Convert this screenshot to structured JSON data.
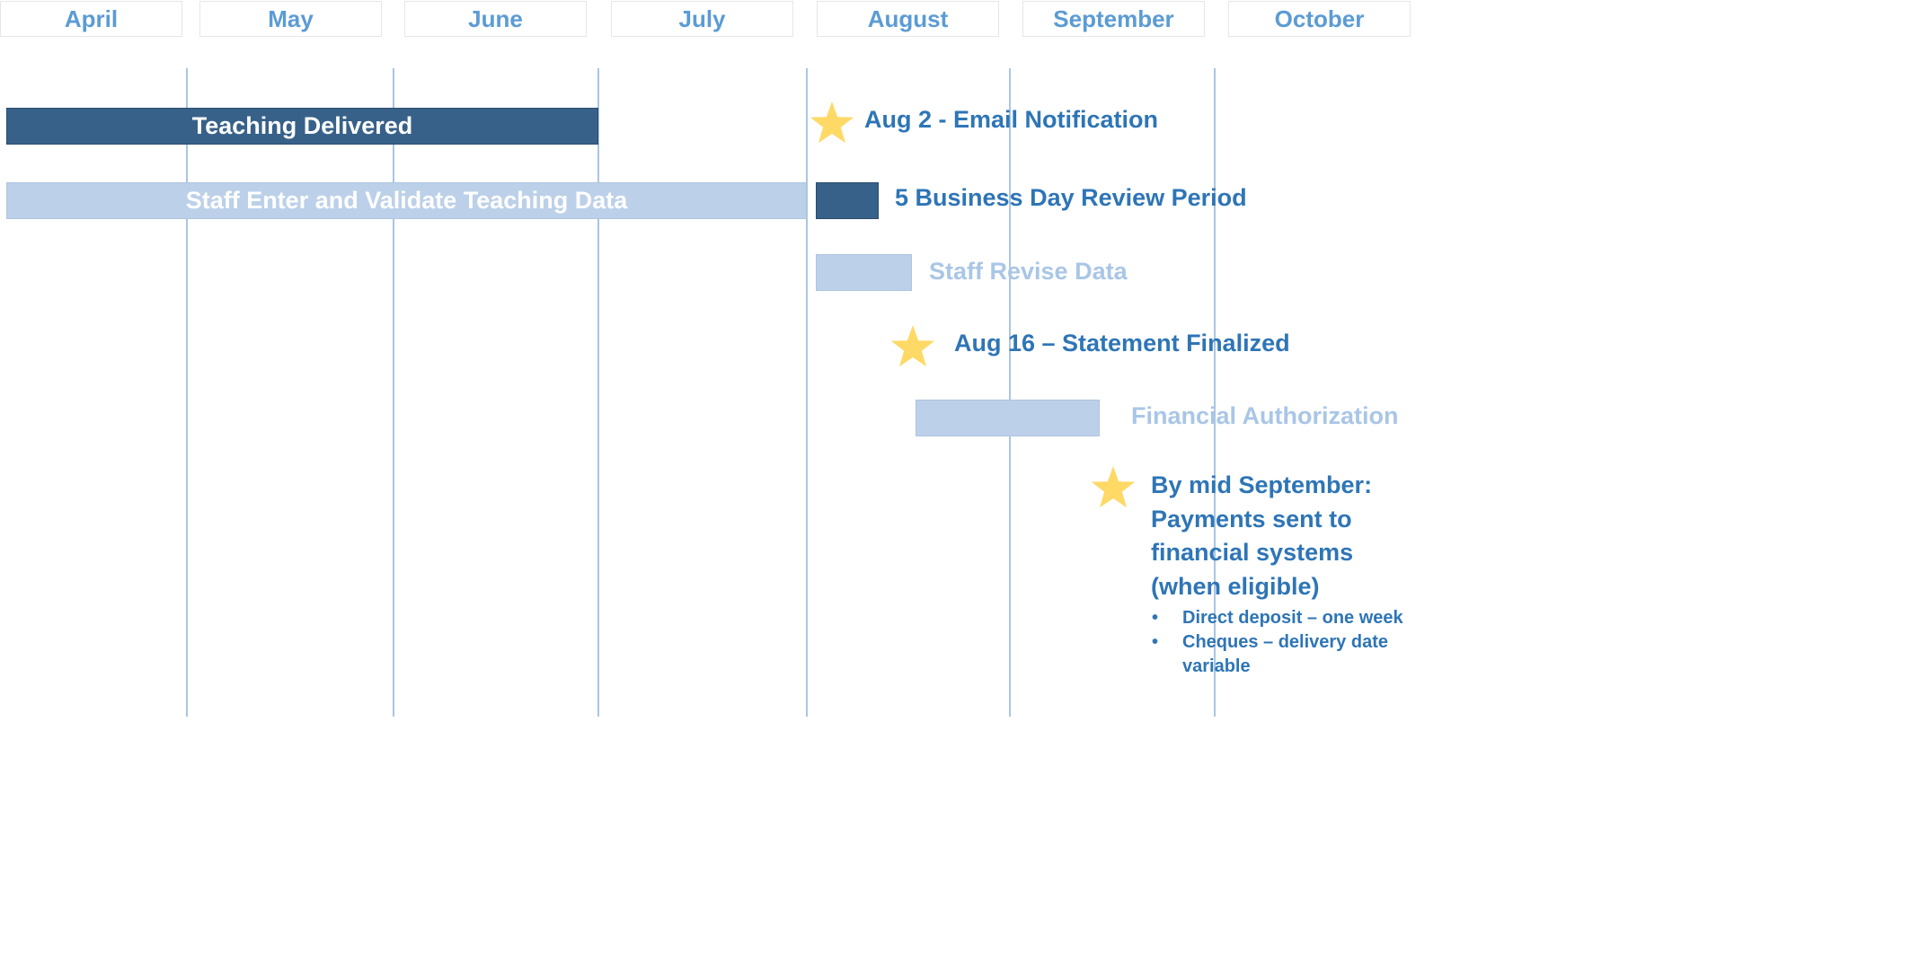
{
  "months": [
    "April",
    "May",
    "June",
    "July",
    "August",
    "September",
    "October"
  ],
  "bars": {
    "teaching_delivered": "Teaching Delivered",
    "staff_enter": "Staff Enter and Validate Teaching Data"
  },
  "events": {
    "email_notification": "Aug 2 - Email Notification",
    "review_period": "5 Business Day Review Period",
    "staff_revise": "Staff Revise Data",
    "statement_finalized": "Aug 16 – Statement Finalized",
    "financial_authorization": "Financial Authorization",
    "payments_line1": "By mid September:",
    "payments_line2": "Payments sent to",
    "payments_line3": "financial systems",
    "payments_line4": "(when eligible)",
    "bullet_direct_deposit": "Direct deposit – one week",
    "bullet_cheques_line1": "Cheques – delivery date",
    "bullet_cheques_line2": "variable"
  },
  "colors": {
    "month_text": "#5b9bd5",
    "dark_bar": "#376189",
    "light_bar": "#bcd0e9",
    "label_dark": "#2e75b6",
    "label_light": "#a9c6e6",
    "star": "#ffd966"
  },
  "icons": {
    "milestone": "star-icon"
  }
}
